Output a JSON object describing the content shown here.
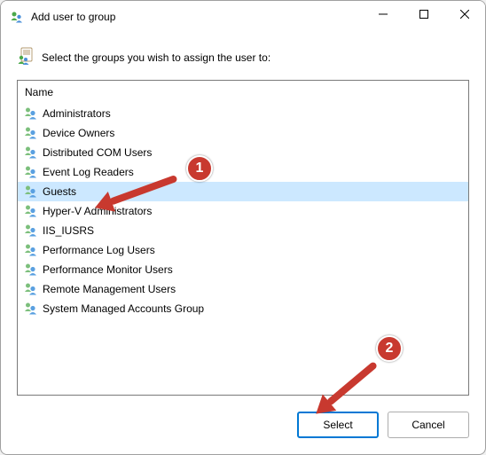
{
  "window": {
    "title": "Add user to group"
  },
  "prompt": {
    "text": "Select the groups you wish to assign the user to:"
  },
  "listbox": {
    "header": "Name",
    "selected_index": 4,
    "items": [
      {
        "label": "Administrators"
      },
      {
        "label": "Device Owners"
      },
      {
        "label": "Distributed COM Users"
      },
      {
        "label": "Event Log Readers"
      },
      {
        "label": "Guests"
      },
      {
        "label": "Hyper-V Administrators"
      },
      {
        "label": "IIS_IUSRS"
      },
      {
        "label": "Performance Log Users"
      },
      {
        "label": "Performance Monitor Users"
      },
      {
        "label": "Remote Management Users"
      },
      {
        "label": "System Managed Accounts Group"
      }
    ]
  },
  "buttons": {
    "select": "Select",
    "cancel": "Cancel"
  },
  "annotations": {
    "badge1": "1",
    "badge2": "2"
  }
}
